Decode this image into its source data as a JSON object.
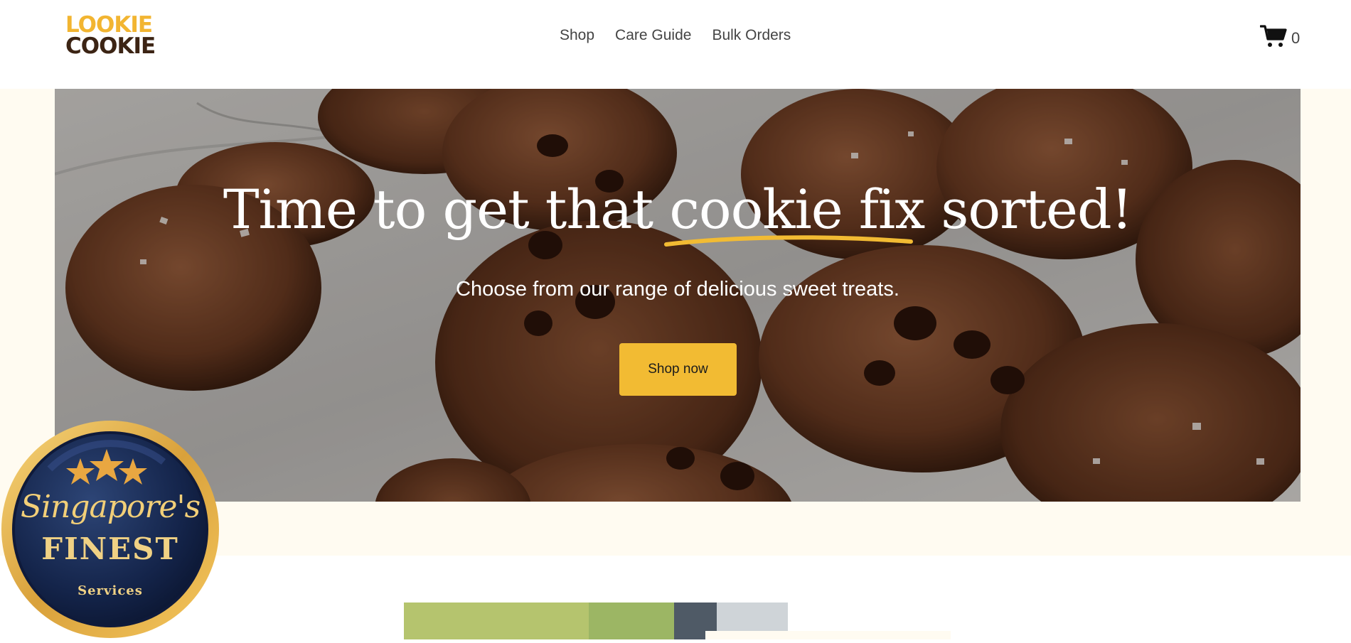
{
  "header": {
    "logo_line1": "LOOKIE",
    "logo_line2": "COOKIE",
    "nav": [
      "Shop",
      "Care Guide",
      "Bulk Orders"
    ],
    "cart_count": "0",
    "cart_icon": "cart-icon"
  },
  "hero": {
    "title_before": "Time to get that ",
    "title_highlight": "cookie fix",
    "title_after": " sorted!",
    "subtitle": "Choose from our range of delicious sweet treats.",
    "button_label": "Shop now"
  },
  "badge": {
    "line1": "Singapore's",
    "line2": "FINEST",
    "line3": "Services",
    "stars": "★★★"
  },
  "colors": {
    "accent": "#f2bb33",
    "logo_yellow": "#f2b531",
    "logo_brown": "#3c2414",
    "band": "#fffbf1"
  }
}
